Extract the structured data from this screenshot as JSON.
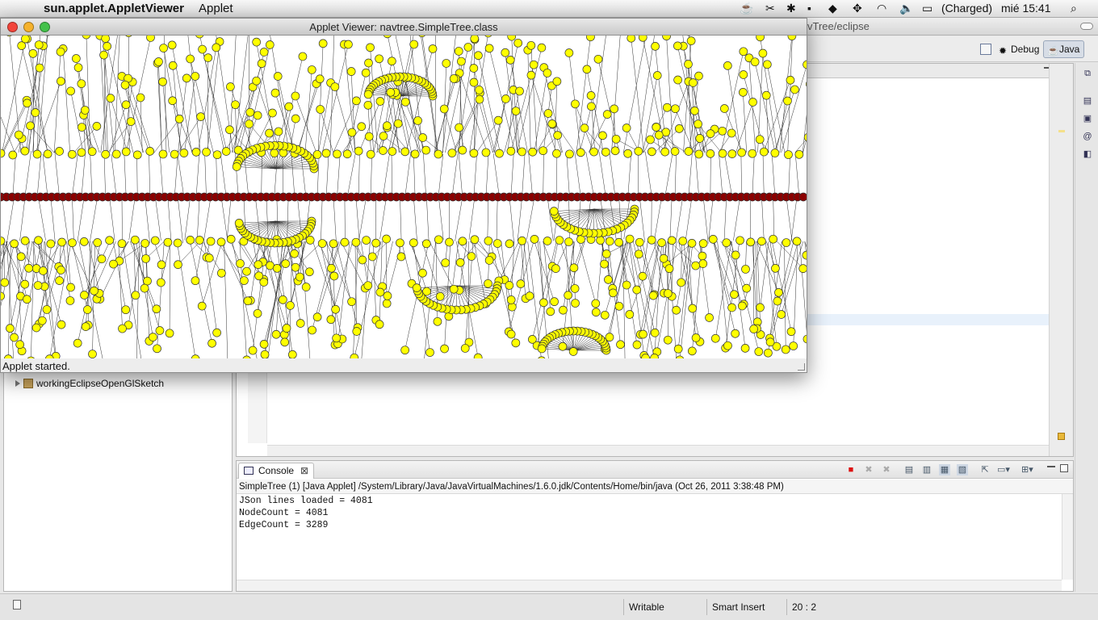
{
  "menubar": {
    "apple_icon": "apple-icon",
    "app_name": "sun.applet.AppletViewer",
    "menus": [
      "Applet"
    ],
    "status_icons": [
      "coffee-icon",
      "cut-icon",
      "star-icon",
      "evernote-icon",
      "dropbox-icon",
      "display-icon",
      "move-icon",
      "wifi-icon",
      "volume-icon",
      "battery-icon"
    ],
    "battery_text": "(Charged)",
    "clock": "mié 15:41",
    "search_icon": "spotlight-icon"
  },
  "eclipse": {
    "window_title_fragment": "vTree/eclipse",
    "perspectives": [
      {
        "label": "Debug",
        "icon": "debug-icon"
      },
      {
        "label": "Java",
        "icon": "java-icon"
      }
    ],
    "package_explorer": {
      "items": [
        {
          "label": "workingEclipseOpenGlSketch"
        }
      ]
    },
    "console": {
      "tab_label": "Console",
      "launch_line": "SimpleTree (1) [Java Applet] /System/Library/Java/JavaVirtualMachines/1.6.0.jdk/Contents/Home/bin/java (Oct 26, 2011 3:38:48 PM)",
      "output": [
        "JSon lines loaded = 4081",
        "NodeCount = 4081",
        "EdgeCount = 3289"
      ]
    },
    "statusbar": {
      "writable": "Writable",
      "insert_mode": "Smart Insert",
      "position": "20 : 2"
    }
  },
  "applet": {
    "title": "Applet Viewer: navtree.SimpleTree.class",
    "status": "Applet started.",
    "colors": {
      "node": "#ffff00",
      "root_node": "#8b0000",
      "edge": "#333333",
      "background": "#ffffff"
    }
  }
}
